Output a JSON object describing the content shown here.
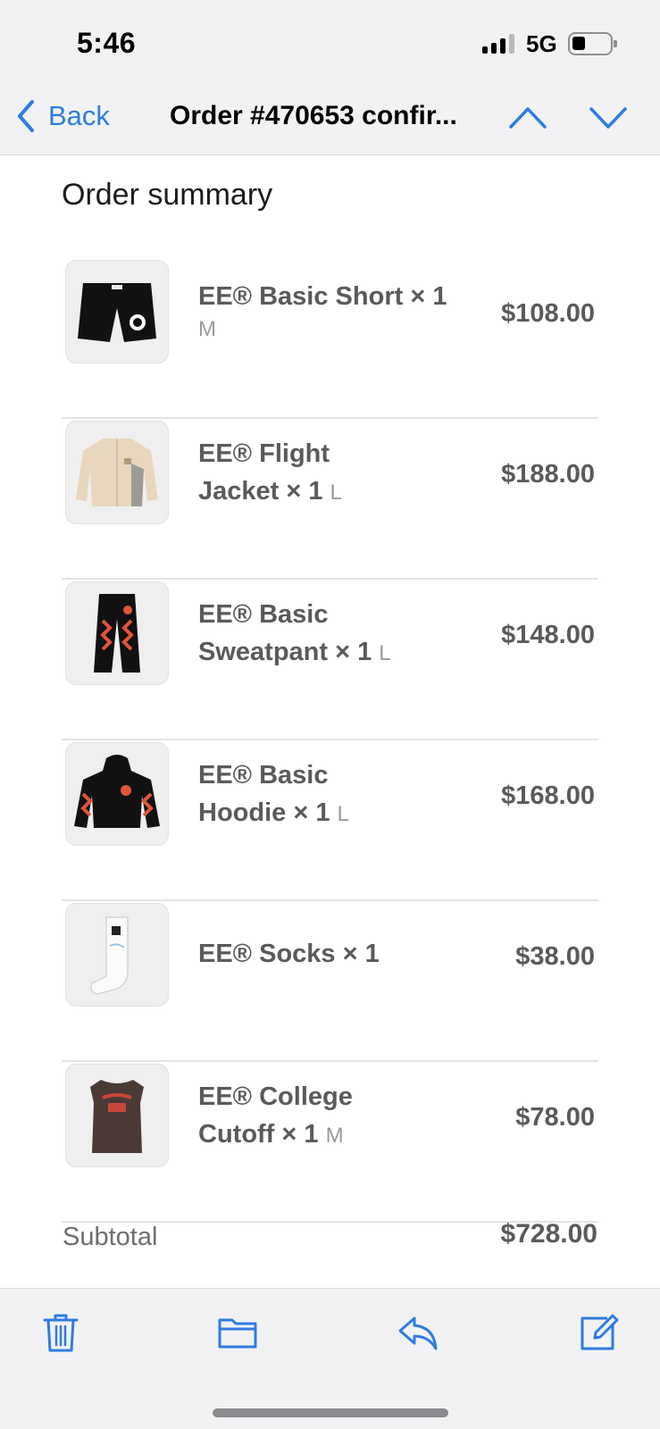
{
  "status_bar": {
    "time": "5:46",
    "network": "5G",
    "signal_bars": 3,
    "battery_level": 0.25
  },
  "nav": {
    "back_label": "Back",
    "title": "Order #470653 confir..."
  },
  "summary": {
    "title": "Order summary",
    "items": [
      {
        "name": "EE® Basic Short × 1",
        "line1": "EE® Basic Short × 1",
        "line2": "",
        "variant": "M",
        "price": "$108.00",
        "icon": "black-shorts-icon"
      },
      {
        "name": "EE® Flight Jacket × 1",
        "line1": "EE® Flight",
        "line2": "Jacket × 1",
        "variant": "L",
        "price": "$188.00",
        "icon": "beige-jacket-icon"
      },
      {
        "name": "EE® Basic Sweatpant × 1",
        "line1": "EE® Basic",
        "line2": "Sweatpant × 1",
        "variant": "L",
        "price": "$148.00",
        "icon": "black-sweatpants-icon"
      },
      {
        "name": "EE® Basic Hoodie × 1",
        "line1": "EE® Basic",
        "line2": "Hoodie × 1",
        "variant": "L",
        "price": "$168.00",
        "icon": "black-hoodie-icon"
      },
      {
        "name": "EE® Socks × 1",
        "line1": "EE® Socks × 1",
        "line2": "",
        "variant": "",
        "price": "$38.00",
        "icon": "white-socks-icon"
      },
      {
        "name": "EE® College Cutoff × 1",
        "line1": "EE® College",
        "line2": "Cutoff × 1",
        "variant": "M",
        "price": "$78.00",
        "icon": "brown-cutoff-tee-icon"
      }
    ],
    "subtotal_label": "Subtotal",
    "subtotal_value": "$728.00"
  },
  "toolbar": {
    "icons": [
      "trash-icon",
      "folder-icon",
      "reply-icon",
      "compose-icon"
    ]
  },
  "colors": {
    "accent": "#2f7ce0",
    "bar_background": "#f2f2f4",
    "text_secondary": "#5a5a5e"
  }
}
